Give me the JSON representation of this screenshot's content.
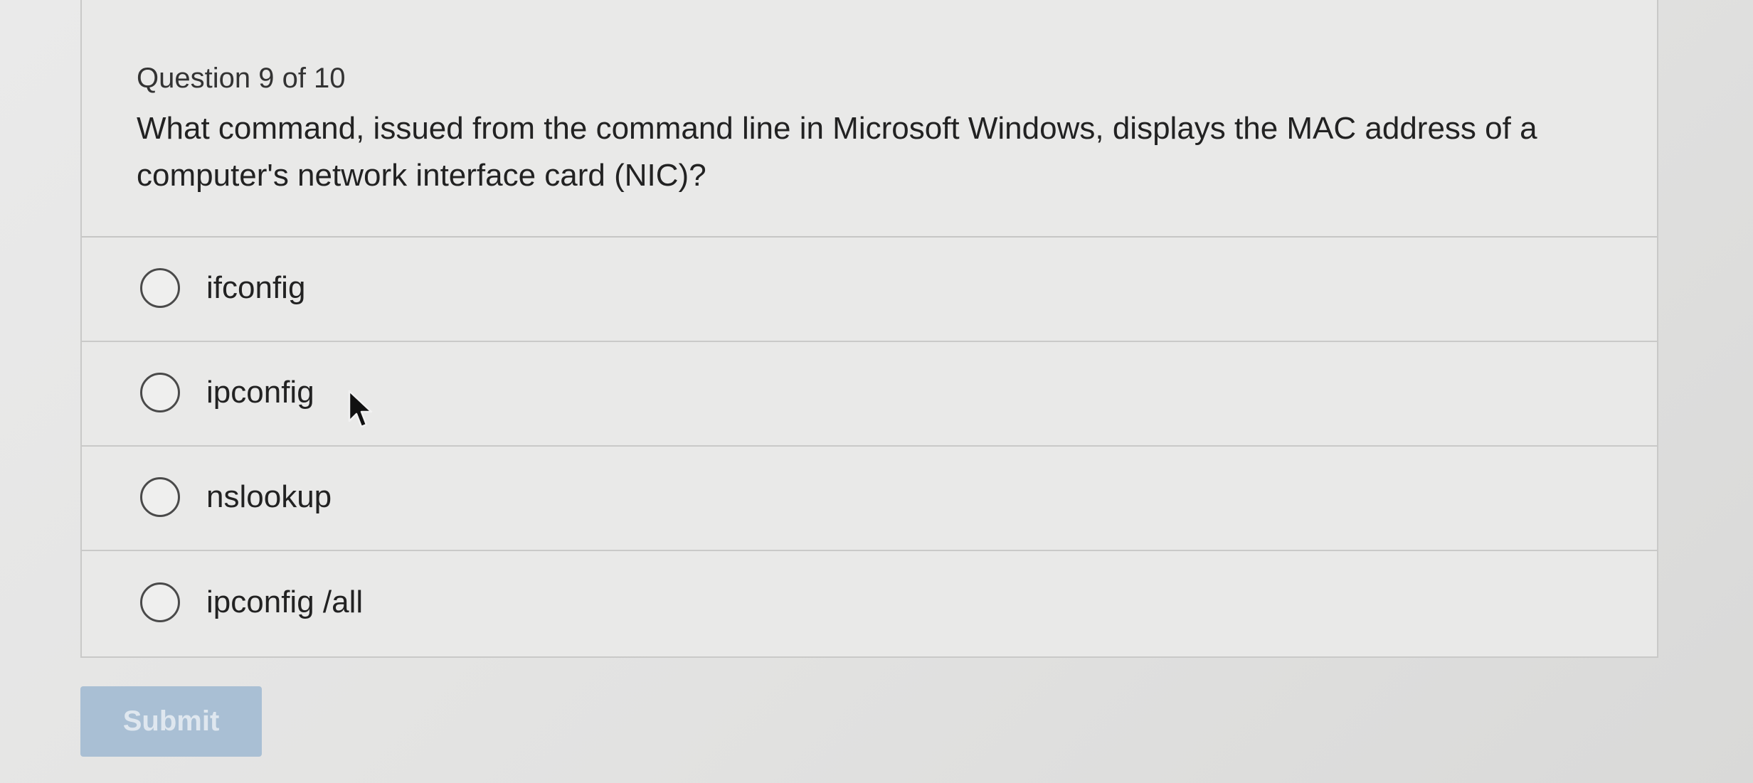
{
  "question": {
    "counter": "Question 9 of 10",
    "text": "What command, issued from the command line in Microsoft Windows, displays the MAC address of a computer's network interface card (NIC)?"
  },
  "options": [
    {
      "label": "ifconfig",
      "selected": false
    },
    {
      "label": "ipconfig",
      "selected": false
    },
    {
      "label": "nslookup",
      "selected": false
    },
    {
      "label": "ipconfig /all",
      "selected": false
    }
  ],
  "submit": {
    "label": "Submit",
    "enabled": false
  },
  "colors": {
    "submit_background": "#a9bfd4",
    "submit_text": "#dfe7ef",
    "card_border": "#c9c9c8"
  },
  "icons": {
    "radio": "radio-button-empty",
    "cursor": "mouse-pointer-arrow"
  }
}
